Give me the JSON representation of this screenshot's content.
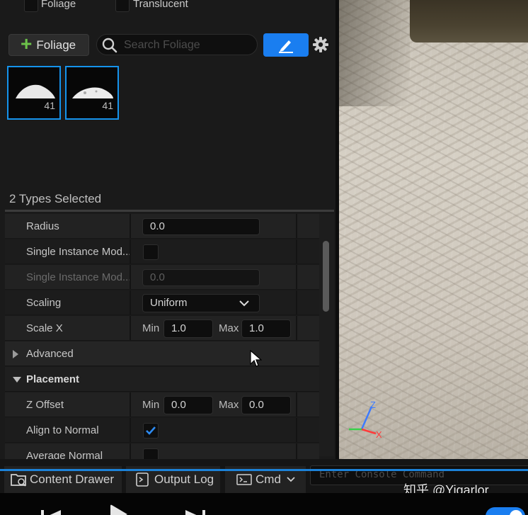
{
  "filters": [
    {
      "label": "Foliage",
      "checked": false
    },
    {
      "label": "Translucent",
      "checked": false
    }
  ],
  "toolbar": {
    "add_foliage_label": "Foliage",
    "search_placeholder": "Search Foliage"
  },
  "thumbnails": [
    {
      "count": "41"
    },
    {
      "count": "41"
    }
  ],
  "types_selected": "2 Types Selected",
  "details": {
    "radius": {
      "label": "Radius",
      "value": "0.0"
    },
    "single_instance_mode": {
      "label": "Single Instance Mod...",
      "checked": false
    },
    "single_instance_mode_value": {
      "label": "Single Instance Mod...",
      "value": "0.0"
    },
    "scaling": {
      "label": "Scaling",
      "value": "Uniform"
    },
    "scale_x": {
      "label": "Scale X",
      "min_label": "Min",
      "min": "1.0",
      "max_label": "Max",
      "max": "1.0"
    },
    "advanced": {
      "label": "Advanced"
    },
    "placement": {
      "label": "Placement"
    },
    "z_offset": {
      "label": "Z Offset",
      "min_label": "Min",
      "min": "0.0",
      "max_label": "Max",
      "max": "0.0"
    },
    "align_to_normal": {
      "label": "Align to Normal",
      "checked": true
    },
    "average_normal": {
      "label": "Average Normal",
      "checked": false
    }
  },
  "viewport_gizmo": {
    "z_label": "Z",
    "x_label": "X"
  },
  "bottombar": {
    "content_drawer": "Content Drawer",
    "output_log": "Output Log",
    "cmd": "Cmd",
    "console_placeholder": "Enter Console Command"
  },
  "watermark": "知乎 @Yigarlor",
  "colors": {
    "accent_blue": "#1a7ef0",
    "selection_blue": "#1593ec",
    "plus_green": "#6cc24a",
    "panel_bg": "#1a1a1a"
  }
}
